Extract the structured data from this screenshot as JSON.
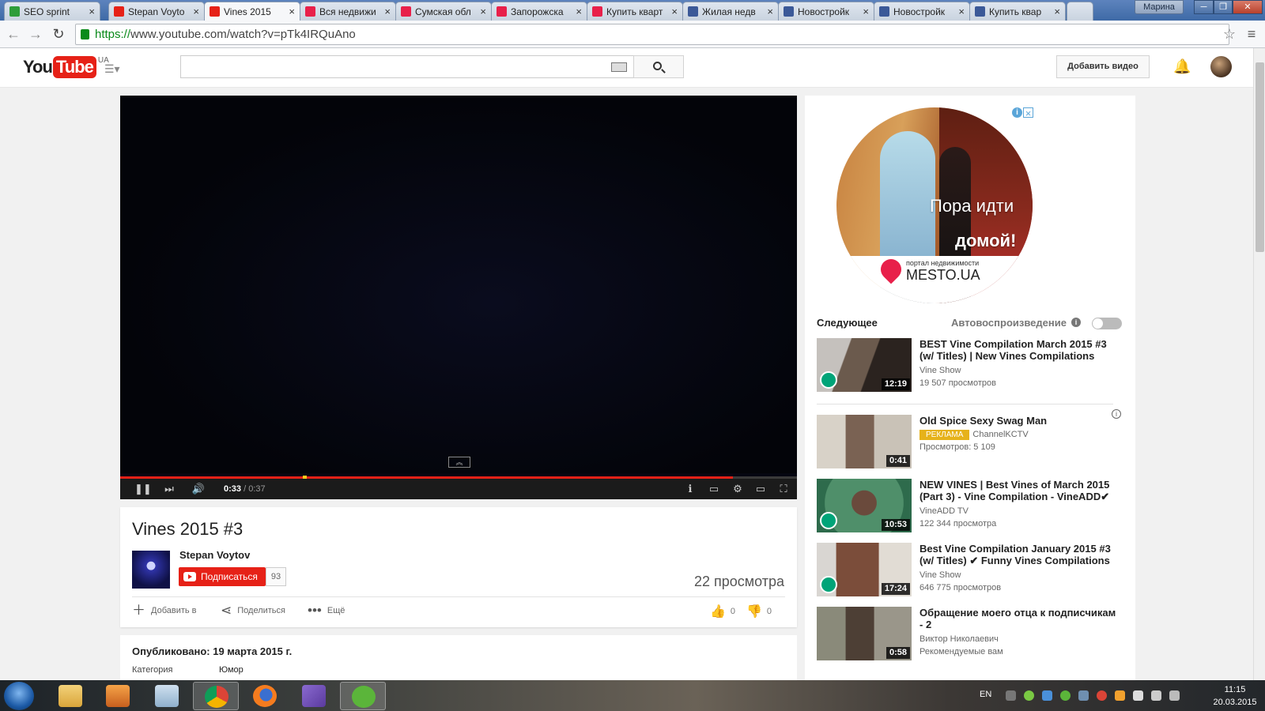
{
  "browser": {
    "tabs": [
      {
        "label": "SEO sprint",
        "color": "#2e9d3a"
      },
      {
        "label": "Stepan Voyto",
        "color": "#e62117"
      },
      {
        "label": "Vines 2015",
        "color": "#e62117"
      },
      {
        "label": "Вся недвижи",
        "color": "#e8204a"
      },
      {
        "label": "Сумская обл",
        "color": "#e8204a"
      },
      {
        "label": "Запорожска",
        "color": "#e8204a"
      },
      {
        "label": "Купить кварт",
        "color": "#e8204a"
      },
      {
        "label": "Жилая недв",
        "color": "#3b5998"
      },
      {
        "label": "Новостройк",
        "color": "#3b5998"
      },
      {
        "label": "Новостройк",
        "color": "#3b5998"
      },
      {
        "label": "Купить квар",
        "color": "#3b5998"
      }
    ],
    "user": "Марина",
    "url_scheme": "https://",
    "url_rest": "www.youtube.com/watch?v=pTk4IRQuAno"
  },
  "youtube": {
    "logo_you": "You",
    "logo_tube": "Tube",
    "region": "UA",
    "search_placeholder": "",
    "upload_label": "Добавить видео"
  },
  "player": {
    "current_time": "0:33",
    "duration": "0:37",
    "played_fraction": 0.905,
    "marker_fraction": 0.27
  },
  "video": {
    "title": "Vines 2015 #3",
    "owner": "Stepan Voytov",
    "subscribe_label": "Подписаться",
    "subscriber_count": "93",
    "views": "22 просмотра",
    "add_to_label": "Добавить в",
    "share_label": "Поделиться",
    "more_label": "Ещё",
    "likes": "0",
    "dislikes": "0",
    "published": "Опубликовано: 19 марта 2015 г.",
    "category_label": "Категория",
    "category_value": "Юмор"
  },
  "ad": {
    "line1": "Пора идти",
    "line2": "домой!",
    "portal": "портал недвижимости",
    "brand": "MESTO.UA"
  },
  "sidebar": {
    "up_next_label": "Следующее",
    "autoplay_label": "Автовоспроизведение",
    "videos": [
      {
        "title": "BEST Vine Compilation March 2015 #3 (w/ Titles) | New Vines Compilations",
        "channel": "Vine Show",
        "views": "19 507 просмотров",
        "duration": "12:19",
        "thumb_color": "#6b5a4d"
      },
      {
        "title": "Old Spice Sexy Swag Man",
        "ad_badge": "РЕКЛАМА",
        "channel": "ChannelKCTV",
        "views": "Просмотров: 5 109",
        "duration": "0:41",
        "thumb_color": "#7a6253"
      },
      {
        "title": "NEW VINES | Best Vines of March 2015 (Part 3) - Vine Compilation - VineADD✔",
        "channel": "VineADD TV",
        "views": "122 344 просмотра",
        "duration": "10:53",
        "thumb_color": "#4f8f6a"
      },
      {
        "title": "Best Vine Compilation January 2015 #3 (w/ Titles) ✔ Funny Vines Compilations",
        "channel": "Vine Show",
        "views": "646 775 просмотров",
        "duration": "17:24",
        "thumb_color": "#7b4d3a"
      },
      {
        "title": "Обращение моего отца к подписчикам - 2",
        "channel": "Виктор Николаевич",
        "views": "Рекомендуемые вам",
        "duration": "0:58",
        "thumb_color": "#6f6a5a"
      }
    ]
  },
  "taskbar": {
    "language": "EN",
    "time": "11:15",
    "date": "20.03.2015"
  }
}
